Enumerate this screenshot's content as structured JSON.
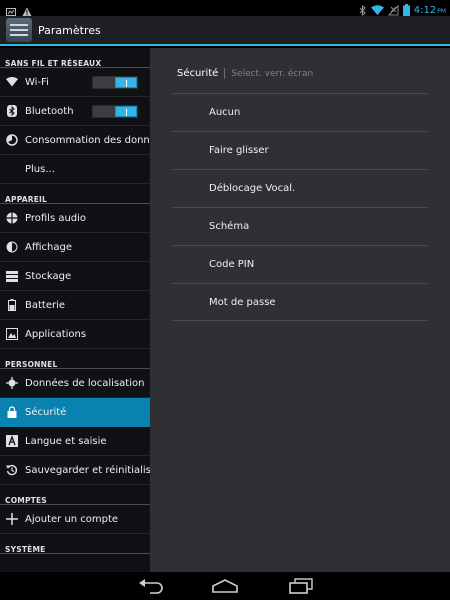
{
  "app": {
    "title": "Paramètres"
  },
  "status": {
    "time": "4:12",
    "ampm": "PM"
  },
  "sidebar": {
    "sections": [
      {
        "header": "Sans fil et réseaux",
        "items": [
          {
            "label": "Wi-Fi",
            "icon": "wifi-icon",
            "toggle": true
          },
          {
            "label": "Bluetooth",
            "icon": "bluetooth-icon",
            "toggle": true
          },
          {
            "label": "Consommation des données",
            "icon": "data-usage-icon"
          },
          {
            "label": "Plus...",
            "icon": ""
          }
        ]
      },
      {
        "header": "Appareil",
        "items": [
          {
            "label": "Profils audio",
            "icon": "audio-profiles-icon"
          },
          {
            "label": "Affichage",
            "icon": "display-icon"
          },
          {
            "label": "Stockage",
            "icon": "storage-icon"
          },
          {
            "label": "Batterie",
            "icon": "battery-icon"
          },
          {
            "label": "Applications",
            "icon": "applications-icon"
          }
        ]
      },
      {
        "header": "Personnel",
        "items": [
          {
            "label": "Données de localisation",
            "icon": "location-icon"
          },
          {
            "label": "Sécurité",
            "icon": "lock-icon",
            "selected": true
          },
          {
            "label": "Langue et saisie",
            "icon": "language-icon"
          },
          {
            "label": "Sauvegarder et réinitialiser",
            "icon": "backup-icon"
          }
        ]
      },
      {
        "header": "Comptes",
        "items": [
          {
            "label": "Ajouter un compte",
            "icon": "add-icon"
          }
        ]
      },
      {
        "header": "Système",
        "items": []
      }
    ]
  },
  "main": {
    "breadcrumb": {
      "current": "Sécurité",
      "sub": "Select. verr. écran"
    },
    "options": [
      "Aucun",
      "Faire glisser",
      "Déblocage Vocal.",
      "Schéma",
      "Code PIN",
      "Mot de passe"
    ]
  },
  "colors": {
    "accent": "#33b5e5",
    "selected": "#0a82b0"
  }
}
